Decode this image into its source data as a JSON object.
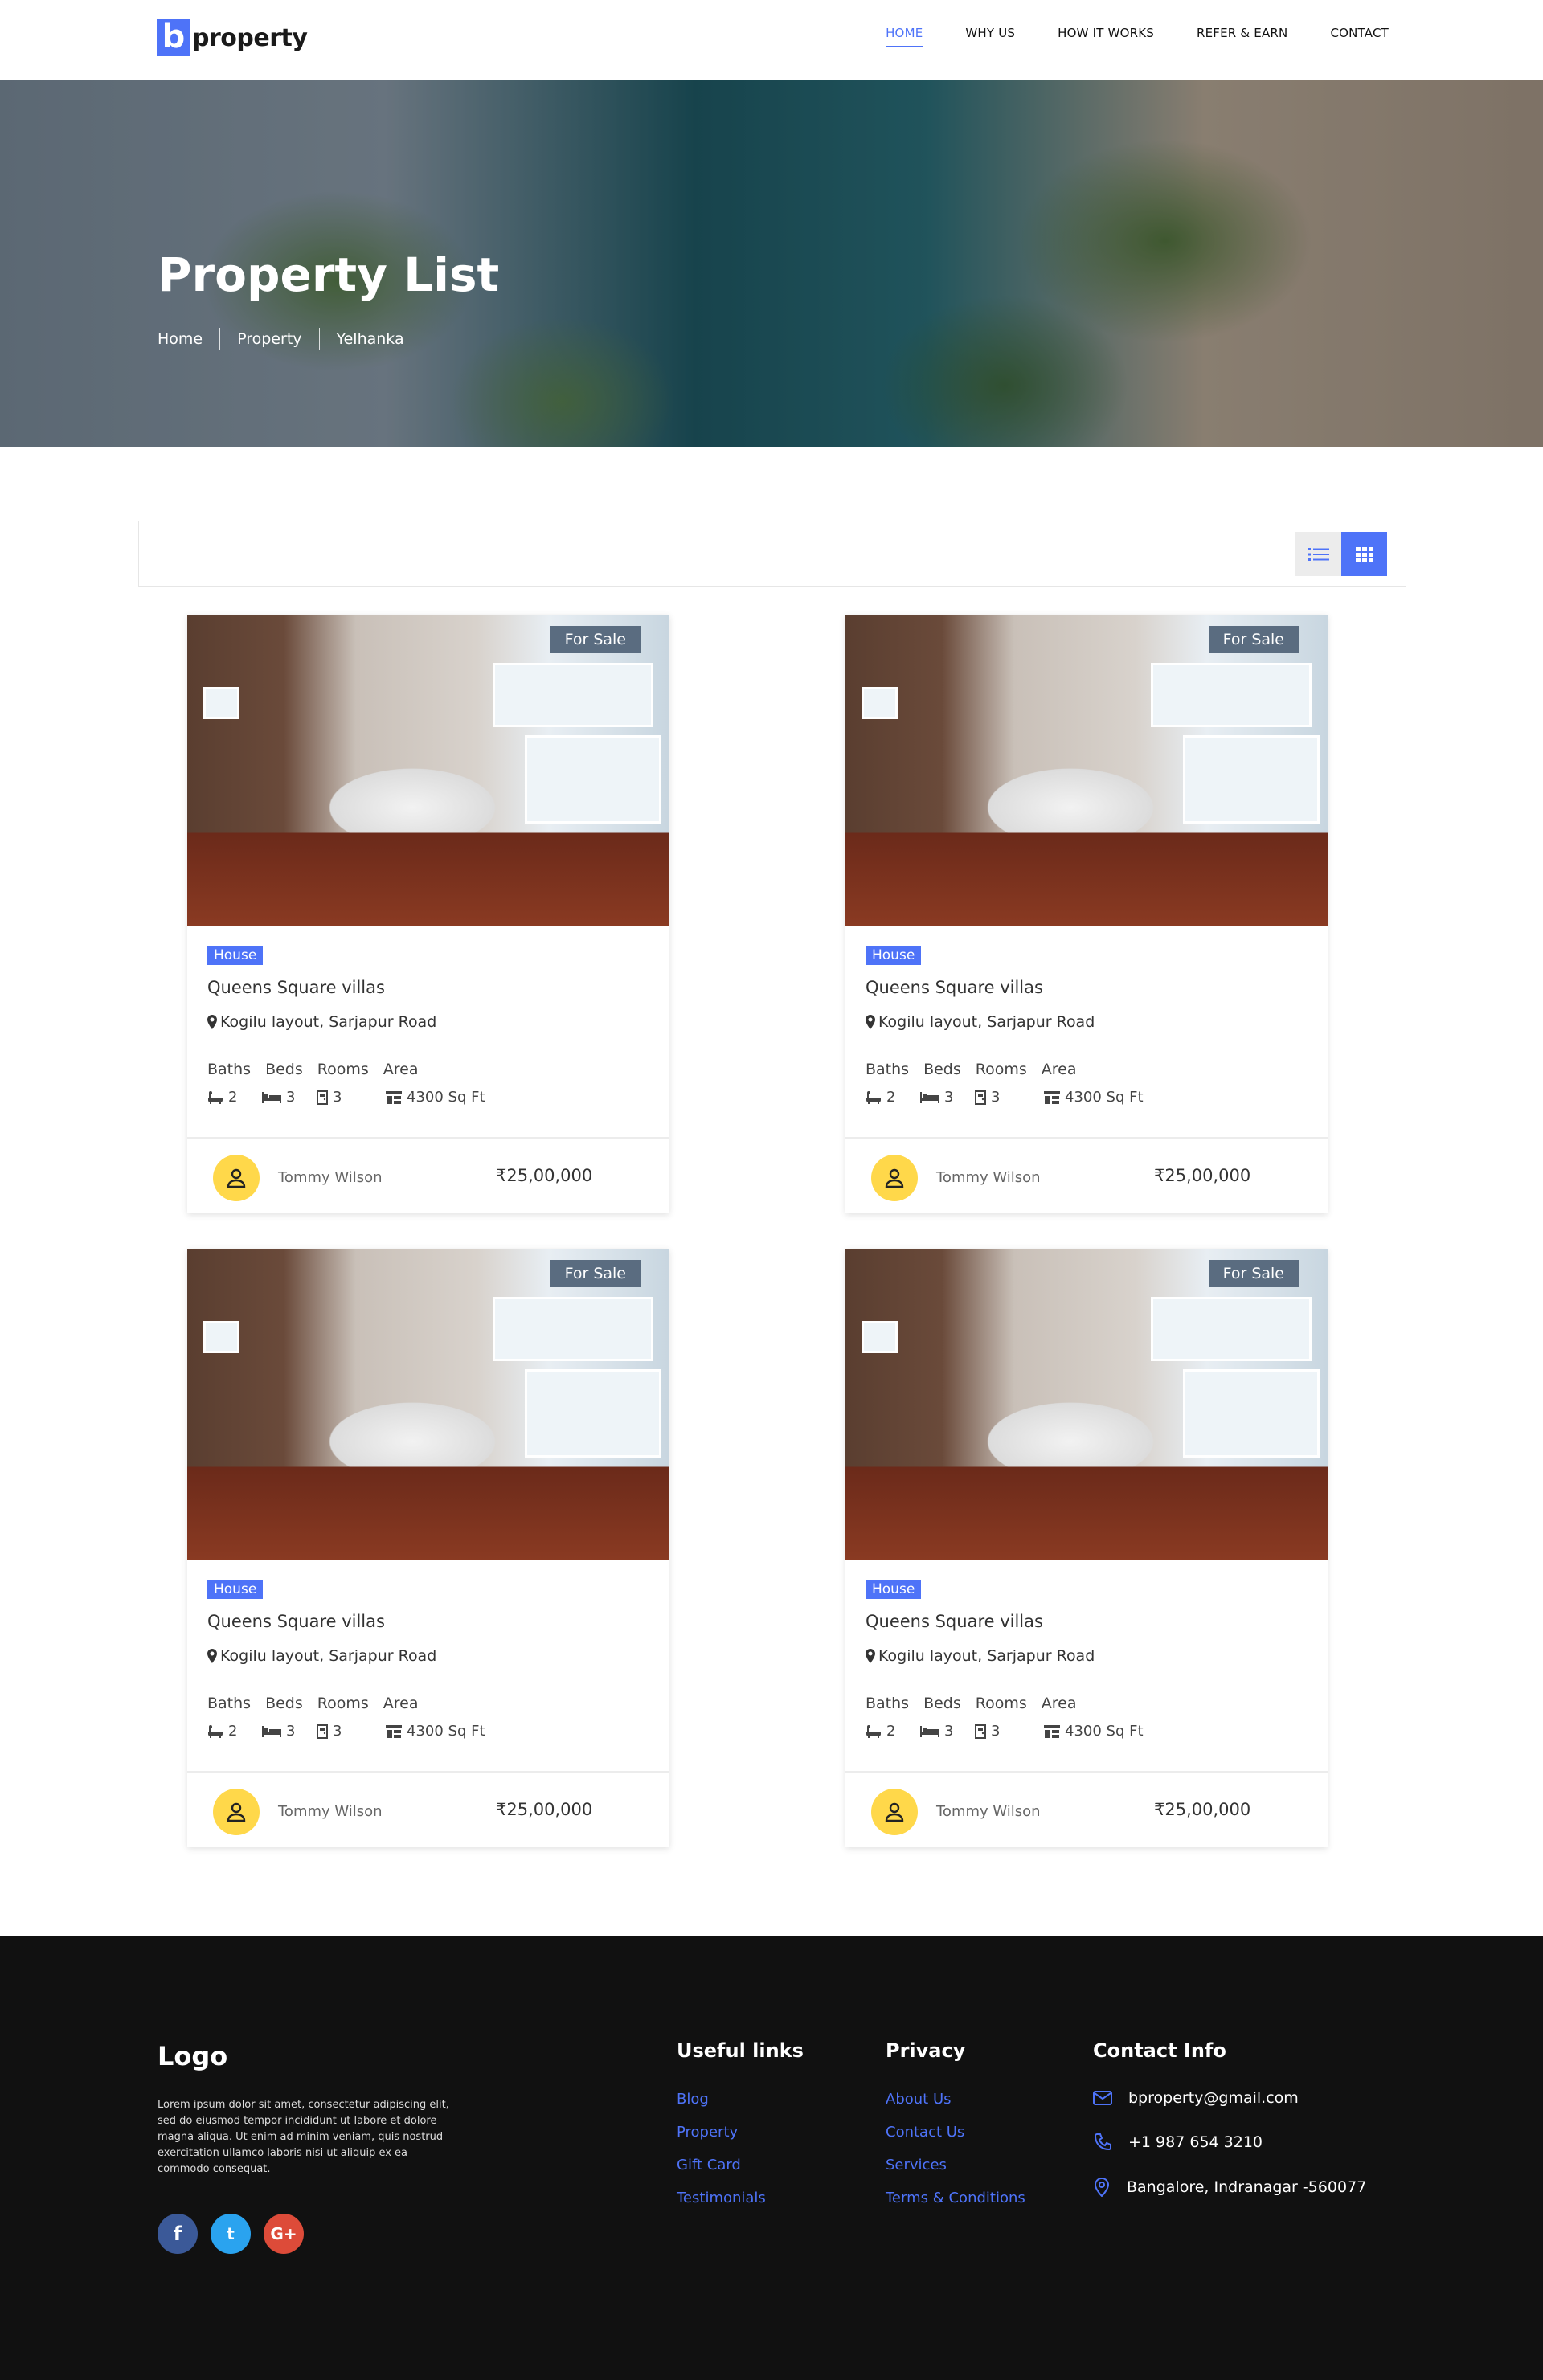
{
  "brand": {
    "logo_letter": "b",
    "logo_text": "property",
    "accent": "#4e73f8"
  },
  "nav": [
    {
      "label": "HOME",
      "active": true
    },
    {
      "label": "WHY US"
    },
    {
      "label": "HOW IT WORKS"
    },
    {
      "label": "REFER & EARN"
    },
    {
      "label": "CONTACT"
    }
  ],
  "hero": {
    "title": "Property List",
    "breadcrumb": [
      "Home",
      "Property",
      "Yelhanka"
    ]
  },
  "toolbar": {
    "views": [
      "list-view-icon",
      "grid-view-icon"
    ],
    "active_view": "grid"
  },
  "listings": [
    {
      "badge": "For Sale",
      "type": "House",
      "title": "Queens Square villas",
      "location": "Kogilu layout, Sarjapur Road",
      "labels": [
        "Baths",
        "Beds",
        "Rooms",
        "Area"
      ],
      "baths": "2",
      "beds": "3",
      "rooms": "3",
      "area": "4300 Sq Ft",
      "agent": "Tommy Wilson",
      "price": "25,00,000"
    },
    {
      "badge": "For Sale",
      "type": "House",
      "title": "Queens Square villas",
      "location": "Kogilu layout, Sarjapur Road",
      "labels": [
        "Baths",
        "Beds",
        "Rooms",
        "Area"
      ],
      "baths": "2",
      "beds": "3",
      "rooms": "3",
      "area": "4300 Sq Ft",
      "agent": "Tommy Wilson",
      "price": "25,00,000"
    },
    {
      "badge": "For Sale",
      "type": "House",
      "title": "Queens Square villas",
      "location": "Kogilu layout, Sarjapur Road",
      "labels": [
        "Baths",
        "Beds",
        "Rooms",
        "Area"
      ],
      "baths": "2",
      "beds": "3",
      "rooms": "3",
      "area": "4300 Sq Ft",
      "agent": "Tommy Wilson",
      "price": "25,00,000"
    },
    {
      "badge": "For Sale",
      "type": "House",
      "title": "Queens Square villas",
      "location": "Kogilu layout, Sarjapur Road",
      "labels": [
        "Baths",
        "Beds",
        "Rooms",
        "Area"
      ],
      "baths": "2",
      "beds": "3",
      "rooms": "3",
      "area": "4300 Sq Ft",
      "agent": "Tommy Wilson",
      "price": "25,00,000"
    }
  ],
  "footer": {
    "logo": "Logo",
    "description": "Lorem ipsum dolor sit amet, consectetur adipiscing elit, sed do eiusmod tempor incididunt ut labore et dolore magna aliqua. Ut enim ad minim veniam, quis nostrud exercitation ullamco laboris nisi ut aliquip ex ea commodo consequat.",
    "social": [
      {
        "icon": "facebook-icon",
        "glyph": "f",
        "color": "#3b5998"
      },
      {
        "icon": "twitter-icon",
        "glyph": "t",
        "color": "#2aa3ef"
      },
      {
        "icon": "google-plus-icon",
        "glyph": "G+",
        "color": "#dd4b39"
      }
    ],
    "useful_links": {
      "title": "Useful links",
      "items": [
        "Blog",
        "Property",
        "Gift Card",
        "Testimonials"
      ]
    },
    "privacy": {
      "title": "Privacy",
      "items": [
        "About Us",
        "Contact Us",
        "Services",
        "Terms & Conditions"
      ]
    },
    "contact": {
      "title": "Contact Info",
      "email": "bproperty@gmail.com",
      "phone": "+1 987 654 3210",
      "address": "Bangalore, Indranagar -560077"
    }
  }
}
